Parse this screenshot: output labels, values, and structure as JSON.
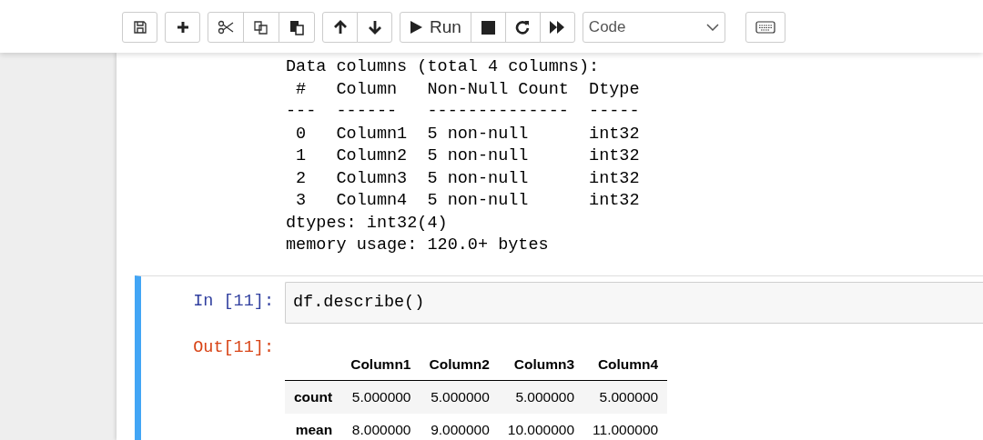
{
  "toolbar": {
    "run_label": "Run",
    "cell_type": "Code"
  },
  "previous_output": {
    "lines": [
      "Data columns (total 4 columns):",
      " #   Column   Non-Null Count  Dtype ",
      "---  ------   --------------  ----- ",
      " 0   Column1  5 non-null      int32",
      " 1   Column2  5 non-null      int32",
      " 2   Column3  5 non-null      int32",
      " 3   Column4  5 non-null      int32",
      "dtypes: int32(4)",
      "memory usage: 120.0+ bytes"
    ]
  },
  "cell": {
    "selected": true,
    "in_prompt": "In [11]:",
    "code": "df.describe()",
    "out_prompt": "Out[11]:",
    "table": {
      "columns": [
        "Column1",
        "Column2",
        "Column3",
        "Column4"
      ],
      "rows": [
        {
          "index": "count",
          "cells": [
            "5.000000",
            "5.000000",
            "5.000000",
            "5.000000"
          ]
        },
        {
          "index": "mean",
          "cells": [
            "8.000000",
            "9.000000",
            "10.000000",
            "11.000000"
          ]
        }
      ]
    }
  }
}
